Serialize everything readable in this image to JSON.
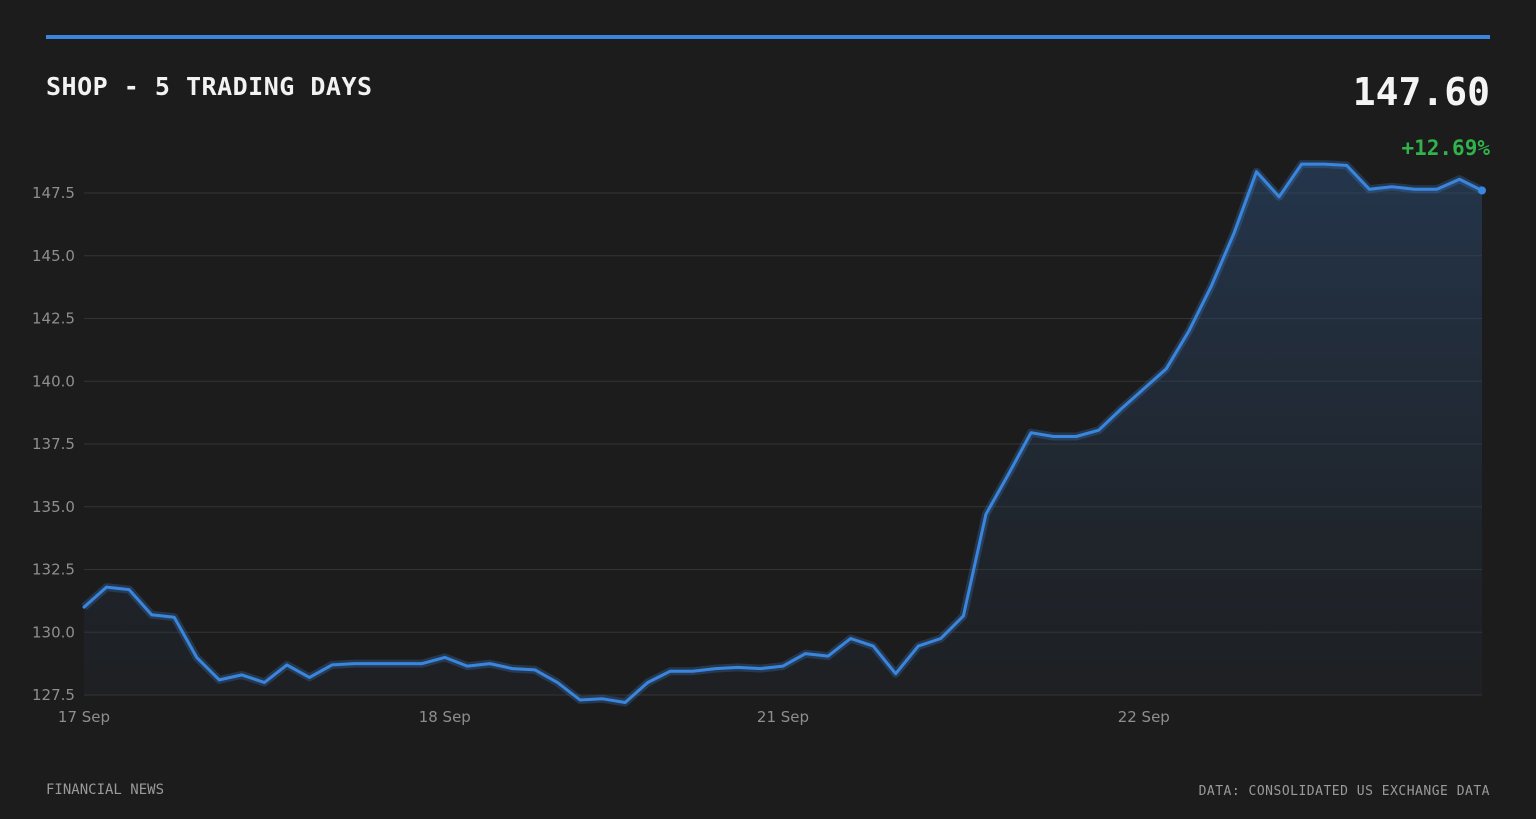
{
  "header": {
    "title": "SHOP - 5 TRADING DAYS",
    "price": "147.60",
    "change": "+12.69%"
  },
  "footer": {
    "source_left": "FINANCIAL NEWS",
    "source_right": "DATA: CONSOLIDATED US EXCHANGE DATA"
  },
  "colors": {
    "background": "#1c1c1c",
    "accent": "#3a86de",
    "positive": "#2fb34a",
    "grid": "#333333",
    "tick_text": "#8e8e8e"
  },
  "chart_data": {
    "type": "area",
    "title": "SHOP - 5 TRADING DAYS",
    "xlabel": "",
    "ylabel": "",
    "ylim": [
      127.5,
      148.5
    ],
    "yticks": [
      "127.5",
      "130.0",
      "132.5",
      "135.0",
      "137.5",
      "140.0",
      "142.5",
      "145.0",
      "147.5"
    ],
    "xticks": [
      {
        "label": "17 Sep",
        "index": 0
      },
      {
        "label": "18 Sep",
        "index": 16
      },
      {
        "label": "21 Sep",
        "index": 31
      },
      {
        "label": "22 Sep",
        "index": 47
      }
    ],
    "grid": true,
    "legend": "none",
    "series": [
      {
        "values": [
          131.0,
          131.8,
          131.7,
          130.7,
          130.6,
          129.0,
          128.1,
          128.3,
          128.0,
          128.7,
          128.2,
          128.7,
          128.75,
          128.75,
          128.75,
          128.75,
          129.0,
          128.65,
          128.75,
          128.55,
          128.5,
          128.0,
          127.3,
          127.35,
          127.2,
          128.0,
          128.45,
          128.45,
          128.55,
          128.6,
          128.55,
          128.65,
          129.15,
          129.05,
          129.75,
          129.45,
          128.35,
          129.45,
          129.75,
          130.65,
          134.7,
          136.3,
          137.95,
          137.8,
          137.8,
          138.05,
          138.9,
          139.7,
          140.5,
          142.0,
          143.8,
          145.9,
          148.35,
          147.35,
          148.65,
          148.65,
          148.6,
          147.65,
          147.75,
          147.65,
          147.65,
          148.05,
          147.6
        ]
      }
    ],
    "last_value": 147.6
  }
}
